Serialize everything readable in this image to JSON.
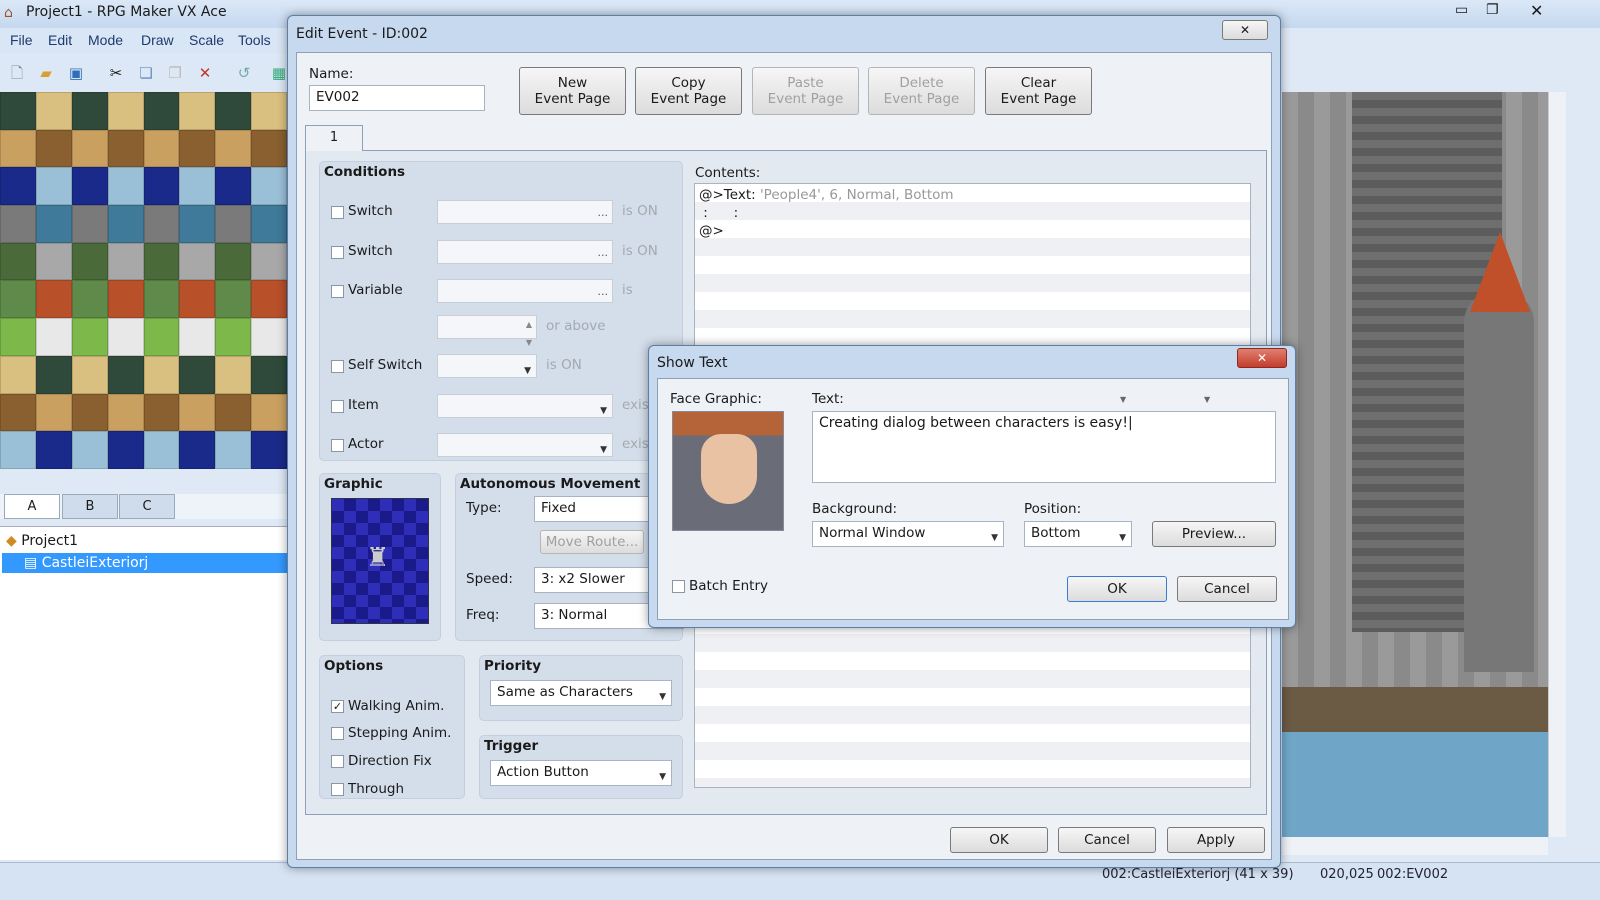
{
  "app": {
    "title": "Project1 - RPG Maker VX Ace",
    "menu": [
      "File",
      "Edit",
      "Mode",
      "Draw",
      "Scale",
      "Tools"
    ],
    "toolbar_icons": [
      "new-icon",
      "open-icon",
      "save-icon",
      "cut-icon",
      "copy-icon",
      "paste-icon",
      "delete-icon",
      "undo-icon",
      "map-icon"
    ],
    "tileset_tabs": [
      "A",
      "B",
      "C"
    ],
    "tree": {
      "project": "Project1",
      "map": "CastleiExteriorj"
    },
    "status": {
      "map": "002:CastleiExteriorj (41 x 39)",
      "coords": "020,025",
      "event": "002:EV002"
    }
  },
  "edit_event": {
    "title": "Edit Event - ID:002",
    "name_label": "Name:",
    "name_value": "EV002",
    "buttons": [
      {
        "label1": "New",
        "label2": "Event Page",
        "enabled": true
      },
      {
        "label1": "Copy",
        "label2": "Event Page",
        "enabled": true
      },
      {
        "label1": "Paste",
        "label2": "Event Page",
        "enabled": false
      },
      {
        "label1": "Delete",
        "label2": "Event Page",
        "enabled": false
      },
      {
        "label1": "Clear",
        "label2": "Event Page",
        "enabled": true
      }
    ],
    "page_tab": "1",
    "conditions": {
      "title": "Conditions",
      "switch1": "Switch",
      "switch2": "Switch",
      "variable": "Variable",
      "self_switch": "Self Switch",
      "item": "Item",
      "actor": "Actor",
      "is_on": "is ON",
      "is": "is",
      "or_above": "or above",
      "exists": "exists",
      "ellipsis": "..."
    },
    "graphic": {
      "title": "Graphic"
    },
    "autonomous": {
      "title": "Autonomous Movement",
      "type_label": "Type:",
      "type_value": "Fixed",
      "move_route": "Move Route...",
      "speed_label": "Speed:",
      "speed_value": "3: x2 Slower",
      "freq_label": "Freq:",
      "freq_value": "3: Normal"
    },
    "options": {
      "title": "Options",
      "items": [
        {
          "label": "Walking Anim.",
          "checked": true
        },
        {
          "label": "Stepping Anim.",
          "checked": false
        },
        {
          "label": "Direction Fix",
          "checked": false
        },
        {
          "label": "Through",
          "checked": false
        }
      ]
    },
    "priority": {
      "title": "Priority",
      "value": "Same as Characters"
    },
    "trigger": {
      "title": "Trigger",
      "value": "Action Button"
    },
    "contents": {
      "label": "Contents:",
      "lines": [
        {
          "prefix": "@>Text: ",
          "args": "'People4', 6, Normal, Bottom"
        },
        {
          "prefix": " :      :",
          "args": ""
        },
        {
          "prefix": "@>",
          "args": ""
        }
      ]
    },
    "footer": {
      "ok": "OK",
      "cancel": "Cancel",
      "apply": "Apply"
    }
  },
  "show_text": {
    "title": "Show Text",
    "face_label": "Face Graphic:",
    "text_label": "Text:",
    "text_value": "Creating dialog between characters is easy!",
    "background_label": "Background:",
    "background_value": "Normal Window",
    "position_label": "Position:",
    "position_value": "Bottom",
    "preview": "Preview...",
    "batch_entry": "Batch Entry",
    "batch_checked": false,
    "ok": "OK",
    "cancel": "Cancel"
  }
}
